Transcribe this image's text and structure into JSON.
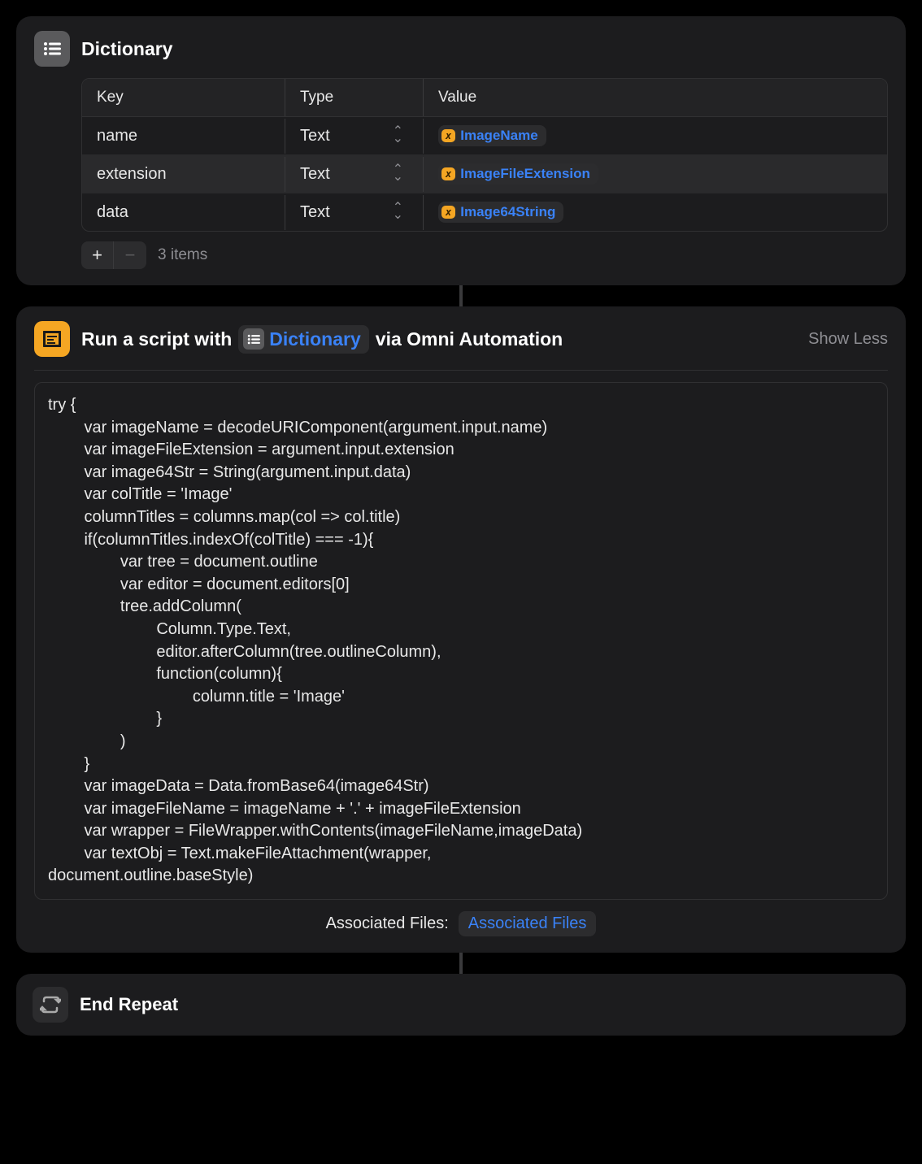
{
  "dictionary": {
    "title": "Dictionary",
    "columns": {
      "key": "Key",
      "type": "Type",
      "value": "Value"
    },
    "rows": [
      {
        "key": "name",
        "type": "Text",
        "var": "ImageName"
      },
      {
        "key": "extension",
        "type": "Text",
        "var": "ImageFileExtension"
      },
      {
        "key": "data",
        "type": "Text",
        "var": "Image64String"
      }
    ],
    "item_count": "3 items"
  },
  "script": {
    "title_prefix": "Run a script with",
    "token_label": "Dictionary",
    "title_suffix": "via Omni Automation",
    "show_less": "Show Less",
    "code": "try {\n        var imageName = decodeURIComponent(argument.input.name)\n        var imageFileExtension = argument.input.extension\n        var image64Str = String(argument.input.data)\n        var colTitle = 'Image'\n        columnTitles = columns.map(col => col.title)\n        if(columnTitles.indexOf(colTitle) === -1){\n                var tree = document.outline\n                var editor = document.editors[0]\n                tree.addColumn(\n                        Column.Type.Text,\n                        editor.afterColumn(tree.outlineColumn),\n                        function(column){\n                                column.title = 'Image'\n                        }\n                )\n        }\n        var imageData = Data.fromBase64(image64Str)\n        var imageFileName = imageName + '.' + imageFileExtension\n        var wrapper = FileWrapper.withContents(imageFileName,imageData)\n        var textObj = Text.makeFileAttachment(wrapper,\ndocument.outline.baseStyle)",
    "associated_label": "Associated Files:",
    "associated_value": "Associated Files"
  },
  "end_repeat": {
    "title": "End Repeat"
  }
}
